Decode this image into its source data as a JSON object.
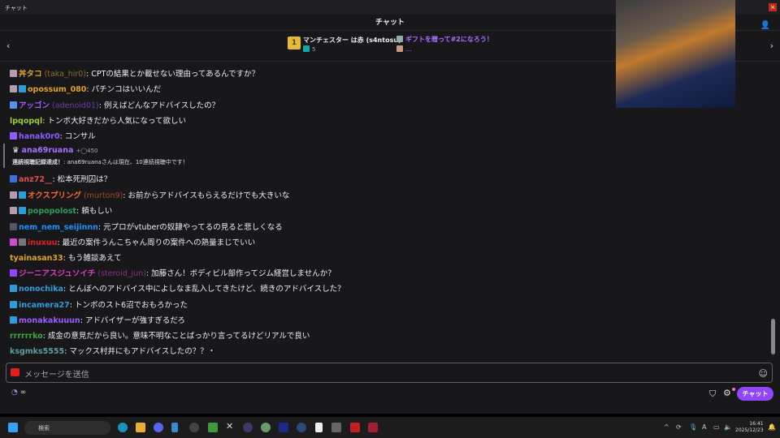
{
  "window": {
    "title": "チャット",
    "header": "チャット"
  },
  "hype": {
    "rank": "1",
    "leader": "マンチェスター は赤 (s4ntosu)",
    "gift_count": "5",
    "cta": "ギフトを贈って#2になろう！",
    "second": "..."
  },
  "messages": [
    {
      "badges": [
        "#b79ab0"
      ],
      "name": "丼タコ",
      "login": "(taka_hir0)",
      "color": "#d9a52b",
      "text": ": CPTの結果とか載せない理由ってあるんですか？"
    },
    {
      "badges": [
        "#b79ab0",
        "#2d9cdb"
      ],
      "name": "opossum_080",
      "login": "",
      "color": "#e0a020",
      "text": ": パチンコはいいんだ"
    },
    {
      "badges": [
        "#5b8def"
      ],
      "name": "アッゴン",
      "login": "(adenoid01)",
      "color": "#9b5cff",
      "text": ": 例えばどんなアドバイスしたの？"
    },
    {
      "badges": [],
      "name": "lpqopql",
      "login": "",
      "color": "#9acd32",
      "text": ": トンボ大好きだから人気になって欲しい"
    },
    {
      "badges": [
        "#8e5cff"
      ],
      "name": "hanak0r0",
      "login": "",
      "color": "#8e5cff",
      "text": ": コンサル"
    },
    {
      "badges": [
        "#3f6fd8"
      ],
      "name": "anz72__",
      "login": "",
      "color": "#e05050",
      "text": ": 松本死刑囚は？"
    },
    {
      "badges": [
        "#b79ab0",
        "#2d9cdb"
      ],
      "name": "オクスプリング",
      "login": "(murton9)",
      "color": "#ff6a2a",
      "text": ": お前からアドバイスもらえるだけでも大きいな"
    },
    {
      "badges": [
        "#b79ab0",
        "#2d9cdb"
      ],
      "name": "popopolost",
      "login": "",
      "color": "#2e9e57",
      "text": ": 頼もしい"
    },
    {
      "badges": [
        "#556"
      ],
      "name": "nem_nem_seijinnn",
      "login": "",
      "color": "#1e90ff",
      "text": ": 元プロがvtuberの奴隷やってるの見ると悲しくなる"
    },
    {
      "badges": [
        "#d04bd0",
        "#777"
      ],
      "name": "inuxuu",
      "login": "",
      "color": "#e02020",
      "text": ": 最近の案件うんこちゃん周りの案件への熱量まじでいい"
    },
    {
      "badges": [],
      "name": "tyainasan33",
      "login": "",
      "color": "#daa520",
      "text": ": もう雑談あえて"
    },
    {
      "badges": [
        "#9147ff"
      ],
      "name": "ジーニアスジュソイチ",
      "login": "(steroid_jun)",
      "color": "#e040c0",
      "text": ": 加藤さん！ボディビル部作ってジム経営しませんか？"
    },
    {
      "badges": [
        "#2d9cdb"
      ],
      "name": "nonochika",
      "login": "",
      "color": "#2d9cdb",
      "text": ": とんぼへのアドバイス中によしなま乱入してきたけど、続きのアドバイスした？"
    },
    {
      "badges": [
        "#2d9cdb"
      ],
      "name": "incamera27",
      "login": "",
      "color": "#2d9cdb",
      "text": ": トンボのスト6沼でおもろかった"
    },
    {
      "badges": [
        "#2d9cdb"
      ],
      "name": "monakakuuun",
      "login": "",
      "color": "#9b5cff",
      "text": ": アドバイザーが強すぎるだろ"
    },
    {
      "badges": [],
      "name": "rrrrrrko",
      "login": "",
      "color": "#3caa3c",
      "text": ": 成金の意見だから良い。意味不明なことばっかり言ってるけどリアルで良い"
    },
    {
      "badges": [],
      "name": "ksgmks5555",
      "login": "",
      "color": "#5f9ea0",
      "text": ": マックス村井にもアドバイスしたの？？・"
    }
  ],
  "resub": {
    "name": "ana69ruana",
    "points": "+◯450",
    "label": "連続視聴記録達成！",
    "text": ": ana69ruanaさんは現在、10連続視聴中です！"
  },
  "input": {
    "placeholder": "メッセージを送信",
    "value": ""
  },
  "bottom": {
    "points": "∞",
    "chat_button": "チャット"
  },
  "taskbar": {
    "search": "検索",
    "time": "16:41",
    "date": "2025/12/23"
  },
  "colors": {
    "accent": "#9147ff",
    "background": "#18181b"
  }
}
